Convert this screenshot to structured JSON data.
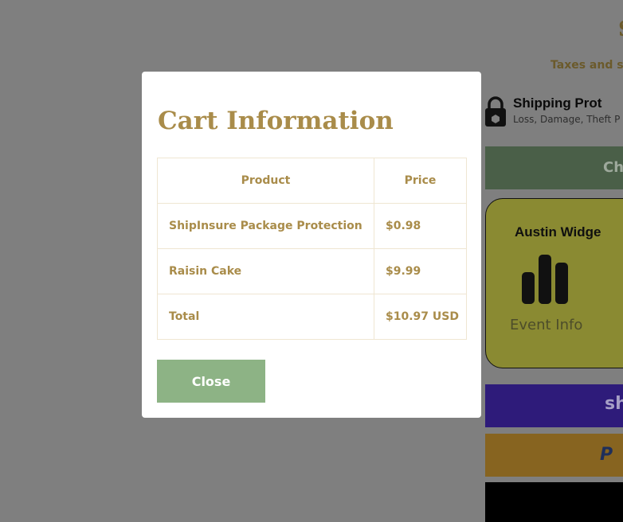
{
  "background": {
    "heading_partial": "S",
    "taxes_text": "Taxes and sh",
    "shipping_protection": {
      "title": "Shipping Prot",
      "subtitle": "Loss, Damage, Theft P"
    },
    "checkout_label": "Che",
    "widget": {
      "title": "Austin Widge",
      "caption": "Event Info"
    },
    "shop_pay_label": "sh",
    "paypal_label": "P"
  },
  "modal": {
    "title": "Cart Information",
    "table": {
      "headers": [
        "Product",
        "Price"
      ],
      "rows": [
        [
          "ShipInsure Package Protection",
          "$0.98"
        ],
        [
          "Raisin Cake",
          "$9.99"
        ],
        [
          "Total",
          "$10.97 USD"
        ]
      ]
    },
    "close_label": "Close"
  },
  "colors": {
    "accent": "#a98c4a",
    "close_button": "#8db385",
    "overlay": "#7f7f7f"
  }
}
